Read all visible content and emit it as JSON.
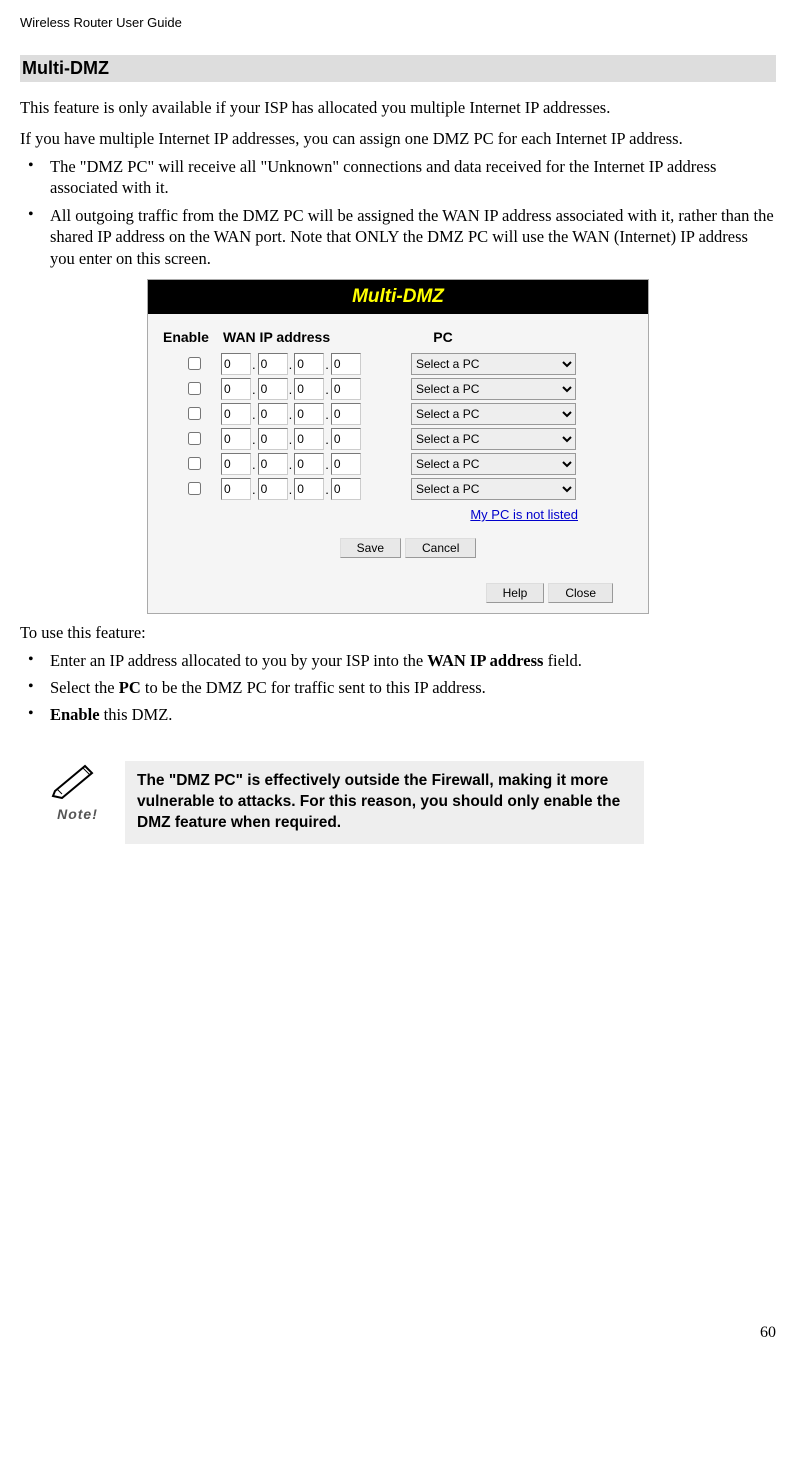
{
  "header": "Wireless Router User Guide",
  "section_heading": "Multi-DMZ",
  "intro_para": "This feature is only available if your ISP has allocated you multiple Internet IP addresses.",
  "intro_para2": "If you have multiple Internet IP addresses, you can assign one DMZ PC for each Internet IP address.",
  "bullets1": [
    "The \"DMZ PC\" will receive all \"Unknown\" connections and data received for the Internet IP address associated with it.",
    "All outgoing traffic from the DMZ PC will be assigned the WAN IP address associated with it, rather than the shared IP address on the WAN port. Note that ONLY the DMZ PC will use the WAN (Internet) IP address you enter on this screen."
  ],
  "figure": {
    "title": "Multi-DMZ",
    "col_enable": "Enable",
    "col_wan": "WAN IP address",
    "col_pc": "PC",
    "ip_val": "0",
    "select_label": "Select a PC",
    "rows_count": 6,
    "link_text": "My PC is not listed",
    "btn_save": "Save",
    "btn_cancel": "Cancel",
    "btn_help": "Help",
    "btn_close": "Close"
  },
  "usage_intro": "To use this feature:",
  "bullets2_pre": [
    "Enter an IP address allocated to you by your ISP into the ",
    "Select the ",
    " this DMZ."
  ],
  "bullets2": [
    {
      "prefix": "Enter an IP address allocated to you by your ISP into the ",
      "bold": "WAN IP address",
      "suffix": " field."
    },
    {
      "prefix": "Select the ",
      "bold": "PC",
      "suffix": " to be the DMZ PC for traffic sent to this IP address."
    },
    {
      "prefix": "",
      "bold": "Enable",
      "suffix": " this DMZ."
    }
  ],
  "note": {
    "label": "Note!",
    "text": "The \"DMZ PC\" is effectively outside the Firewall, making it more vulnerable to attacks. For this reason, you should only enable the DMZ feature when required."
  },
  "page_number": "60"
}
